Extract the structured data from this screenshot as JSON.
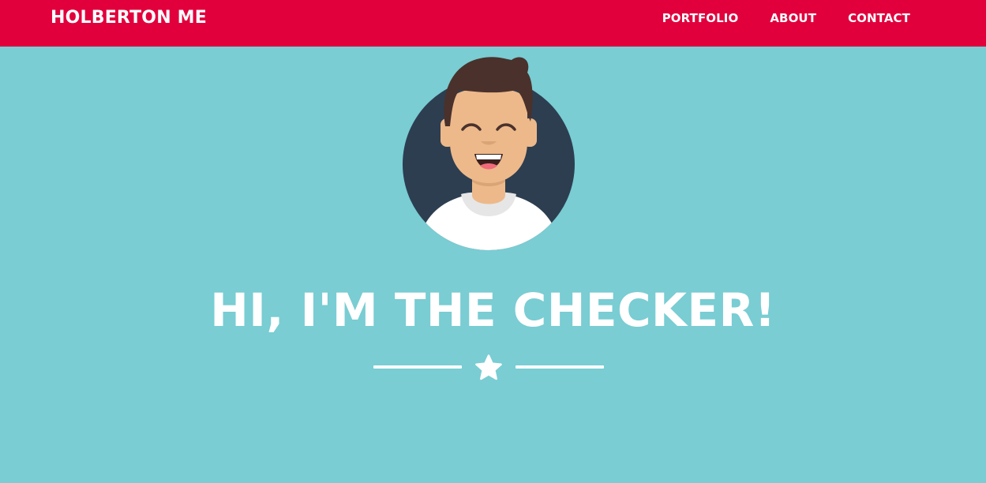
{
  "navbar": {
    "brand": "HOLBERTON ME",
    "links": [
      {
        "label": "PORTFOLIO"
      },
      {
        "label": "ABOUT"
      },
      {
        "label": "CONTACT"
      }
    ],
    "background": "#e1003c"
  },
  "hero": {
    "title": "HI, I'M THE CHECKER!",
    "avatar_icon": "smiling-person-avatar-icon",
    "divider_icon": "star-icon",
    "background": "#79cdd3"
  }
}
